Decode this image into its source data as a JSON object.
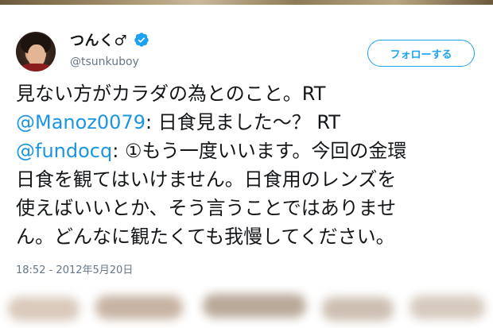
{
  "tweet": {
    "display_name": "つんく♂",
    "handle": "@tsunkuboy",
    "verified_icon": "verified-badge-icon",
    "follow_label": "フォローする",
    "text_lines": [
      [
        {
          "t": "見ない方がカラダの為とのこと。RT",
          "m": false
        }
      ],
      [
        {
          "t": "@Manoz0079",
          "m": true
        },
        {
          "t": ": 日食見ました〜？ RT",
          "m": false
        }
      ],
      [
        {
          "t": "@fundocq",
          "m": true
        },
        {
          "t": ": ①もう一度いいます。今回の金環",
          "m": false
        }
      ],
      [
        {
          "t": "日食を観てはいけません。日食用のレンズを",
          "m": false
        }
      ],
      [
        {
          "t": "使えばいいとか、そう言うことではありませ",
          "m": false
        }
      ],
      [
        {
          "t": "ん。どんなに観たくても我慢してください。",
          "m": false
        }
      ]
    ],
    "timestamp": "18:52 - 2012年5月20日"
  },
  "colors": {
    "accent": "#1da1f2",
    "mention": "#1b95e0",
    "text": "#14171a",
    "muted": "#657786"
  }
}
